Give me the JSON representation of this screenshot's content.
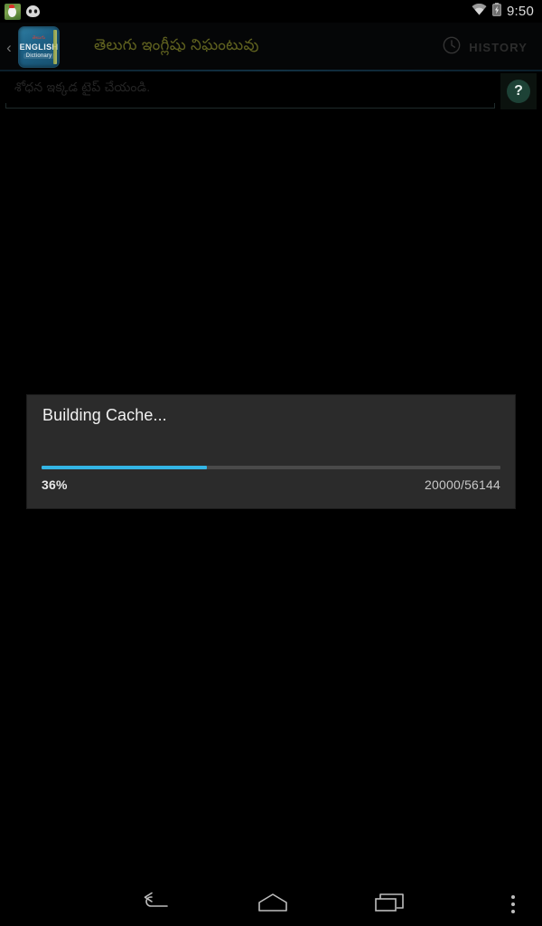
{
  "status_bar": {
    "notifications": [
      {
        "icon": "rooster-app-icon"
      },
      {
        "icon": "cyanogenmod-icon"
      }
    ],
    "wifi_icon": "wifi-icon",
    "battery_icon": "battery-charging-icon",
    "time": "9:50"
  },
  "action_bar": {
    "up_chevron": "‹",
    "app_icon": {
      "name": "dictionary-app-icon",
      "telugu_line": "తెలుగు",
      "english_line": "ENGLISH",
      "subtitle_line": "Dictionary"
    },
    "title": "తెలుగు ఇంగ్లీషు నిఘంటువు",
    "title_color": "#60621f",
    "history_button": {
      "icon": "clock-icon",
      "label": "HISTORY"
    }
  },
  "search": {
    "placeholder": "శోధన ఇక్కడ టైప్ చేయండి.",
    "value": "",
    "help_button": {
      "icon": "help-question-icon",
      "label": "?"
    }
  },
  "dialog": {
    "title": "Building Cache...",
    "progress_percent_label": "36%",
    "progress_percent_value": 36,
    "progress_count": "20000/56144",
    "current": 20000,
    "total": 56144,
    "accent_color": "#33b5e5",
    "background_color": "#2b2b2b"
  },
  "nav_bar": {
    "back": "back-icon",
    "home": "home-icon",
    "recents": "recents-icon",
    "overflow": "overflow-menu-icon"
  }
}
